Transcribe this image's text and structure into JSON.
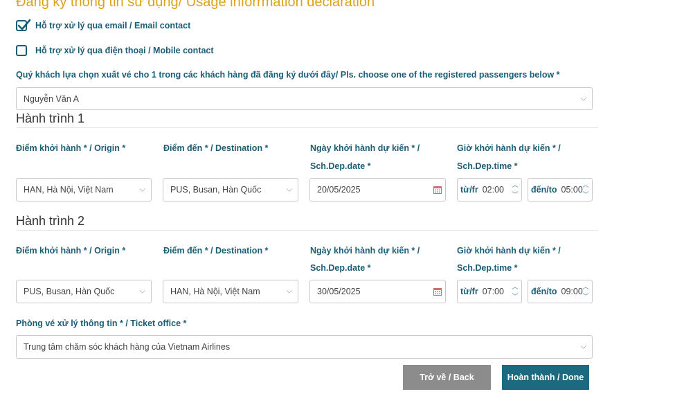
{
  "heading": "Đăng ký thông tin sử dụng/ Usage inforrmation declaration",
  "contacts": {
    "email": {
      "label": "Hỗ trợ xử lý qua email / Email contact",
      "checked": true
    },
    "mobile": {
      "label": "Hỗ trợ xử lý qua điện thoại / Mobile contact",
      "checked": false
    }
  },
  "passenger": {
    "label": "Quý khách lựa chọn xuất vé cho 1 trong các khách hàng đã đăng ký dưới đây/ Pls. choose one of the registered passengers below *",
    "value": "Nguyễn Văn A"
  },
  "labels": {
    "origin": "Điểm khởi hành * / Origin *",
    "destination": "Điểm đến * / Destination *",
    "dep_date_1": "Ngày khởi hành dự kiến * /",
    "dep_date_2": "Sch.Dep.date *",
    "dep_time_1": "Giờ khởi hành dự kiến * /",
    "dep_time_2": "Sch.Dep.time *",
    "from": "từ/fr",
    "to": "đến/to"
  },
  "legs": [
    {
      "title": "Hành trình 1",
      "origin": "HAN, Hà Nội, Việt Nam",
      "destination": "PUS, Busan, Hàn Quốc",
      "date": "20/05/2025",
      "time_from": "02:00",
      "time_to": "05:00"
    },
    {
      "title": "Hành trình 2",
      "origin": "PUS, Busan, Hàn Quốc",
      "destination": "HAN, Hà Nội, Việt Nam",
      "date": "30/05/2025",
      "time_from": "07:00",
      "time_to": "09:00"
    }
  ],
  "ticket_office": {
    "label": "Phòng vé xử lý thông tin * / Ticket office *",
    "value": "Trung tâm chăm sóc khách hàng của Vietnam Airlines"
  },
  "buttons": {
    "back": "Trở về / Back",
    "done": "Hoàn thành / Done"
  },
  "colors": {
    "heading": "#d9a31c",
    "label": "#1a5d75",
    "back_button": "#8c8c8c",
    "done_button": "#1b6a80"
  }
}
